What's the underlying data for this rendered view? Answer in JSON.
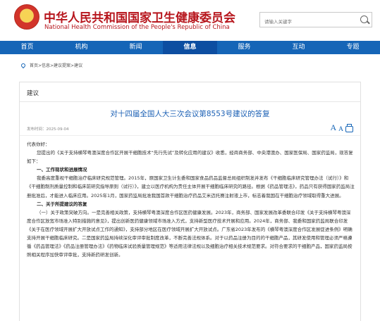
{
  "site": {
    "title_cn": "中华人民共和国国家卫生健康委员会",
    "title_en": "National Health Commission of the People's Republic of China"
  },
  "search": {
    "placeholder": "请输入关键字"
  },
  "nav": [
    "首页",
    "机构",
    "新闻",
    "信息",
    "服务",
    "互动",
    "专题"
  ],
  "nav_active_index": 3,
  "breadcrumb": "首页>信息>建议提案>建议",
  "panel": {
    "tab": "建议"
  },
  "article": {
    "title": "对十四届全国人大三次会议第8553号建议的答复",
    "date_label": "发布时间：",
    "date": "2025-09-04",
    "font_large": "A",
    "font_small": "A",
    "paragraphs": [
      {
        "type": "text",
        "text": "代表你好："
      },
      {
        "type": "indent",
        "text": "您提出的《关于支持横琴粤澳深度合作区开展干细胞技术“先行先试”及转化应用的建议》收悉，经商商务部、中央港澳办、国家医保局、国家药监局，现答复如下："
      },
      {
        "type": "heading",
        "text": "一、工作现状和进展情况"
      },
      {
        "type": "indent",
        "text": "我委高度重视干细胞治疗临床研究规范管理。2015年，原国家卫生计生委和国家食品药品监督总局组织制发并发布《干细胞临床研究管理办法（试行）》和《干细胞制剂质量控制和临床前研究指导原则（试行）》，建立以医疗机构为责任主体开展干细胞临床研究的路径。根据《药品管理法》，药品只有获得国家药监局注册批准后，才能进入临床应用。2025年1月，国家药监局批准我国首款干细胞治疗药品艾米迈托赛注射液上市，标志着我国在干细胞治疗领域取得重大进展。"
      },
      {
        "type": "heading",
        "text": "二、关于所提建议的答复"
      },
      {
        "type": "indent",
        "text": "（一）关于政策突破方向。一是完善相关政策，支持横琴粤澳深度合作区医药健康发展。2023年，商务部、国家发展改革委联合印发《关于支持横琴粤澳深度合作区放宽市场准入特别措施的意见》，提出创新医药健康领域市场准入方式，支持新型医疗技术开展和应用。2024年，商务部、我委和国家药监局联合印发《关于在医疗领域开展扩大开放试点工作的通知》，支持部分地区在医疗领域开展扩大开放试点。广东省2023年发布的《横琴粤澳深度合作区发展促进条例》明确支持开展干细胞临床研究。二是国家药监局持续深化审评审批制度改革，不断完善法规体系。对于以药品注册为目的的干细胞产品，其研发使用和管理必须严格遵循《药品管理法》《药品注册管理办法》《药物临床试验质量管理规范》等适用法律法规以及细胞治疗相关技术规范要求。对符合要求的干细胞产品，国家药监局按照相关程序加快审评审批，支持新药研发创新。"
      }
    ]
  }
}
